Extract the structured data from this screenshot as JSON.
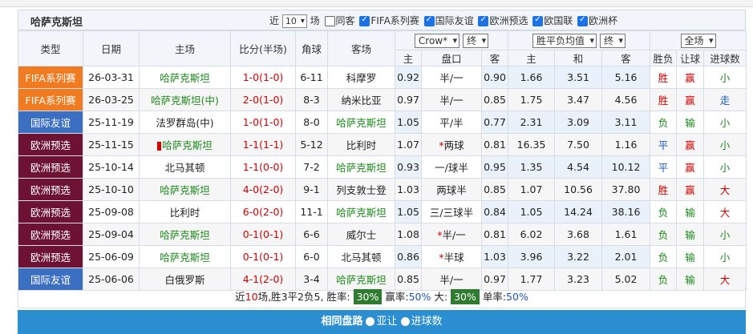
{
  "header": {
    "team": "哈萨克斯坦",
    "recent_prefix": "近",
    "recent_count": "10",
    "field_label": "场",
    "same_home_label": "同客",
    "filters": [
      {
        "label": "FIFA系列赛",
        "checked": true
      },
      {
        "label": "国际友谊",
        "checked": true
      },
      {
        "label": "欧洲预选",
        "checked": true
      },
      {
        "label": "欧国联",
        "checked": true
      },
      {
        "label": "欧洲杯",
        "checked": true
      }
    ]
  },
  "columns": {
    "type": "类型",
    "date": "日期",
    "home": "主场",
    "score": "比分(半场)",
    "corner": "角球",
    "away": "客场",
    "company_select": "Crow*",
    "period_select1": "终",
    "odds_select": "胜平负均值",
    "period_select2": "终",
    "scope_select": "全场",
    "result": "胜负",
    "handicap_result": "让球",
    "goals": "进球数",
    "sub": {
      "h1": "主",
      "line": "盘口",
      "a1": "客",
      "h2": "主",
      "draw": "和",
      "a2": "客"
    }
  },
  "rows": [
    {
      "league": "FIFA系列赛",
      "league_color": "#f07b20",
      "date": "26-03-31",
      "home": "哈萨克斯坦",
      "home_cls": "green",
      "score": "1-0",
      "half": "(1-0)",
      "corner": "6-11",
      "away": "科摩罗",
      "away_cls": "",
      "h1": "0.92",
      "line": "半/一",
      "a1": "0.90",
      "h2": "1.66",
      "d": "3.51",
      "a2": "5.16",
      "res": "胜",
      "res_cls": "red",
      "hcp": "赢",
      "hcp_cls": "red",
      "goals": "小",
      "goals_cls": "green"
    },
    {
      "league": "FIFA系列赛",
      "league_color": "#f07b20",
      "date": "26-03-25",
      "home": "哈萨克斯坦(中)",
      "home_cls": "green",
      "score": "2-0",
      "half": "(1-0)",
      "corner": "8-3",
      "away": "纳米比亚",
      "away_cls": "",
      "h1": "0.97",
      "line": "半/一",
      "a1": "0.85",
      "h2": "1.75",
      "d": "3.47",
      "a2": "4.56",
      "res": "胜",
      "res_cls": "red",
      "hcp": "赢",
      "hcp_cls": "red",
      "goals": "走",
      "goals_cls": "blue"
    },
    {
      "league": "国际友谊",
      "league_color": "#3b6fc2",
      "date": "25-11-19",
      "home": "法罗群岛(中)",
      "home_cls": "",
      "score": "1-0",
      "half": "(1-0)",
      "corner": "8-0",
      "away": "哈萨克斯坦",
      "away_cls": "green",
      "h1": "1.05",
      "line": "平/半",
      "a1": "0.77",
      "h2": "2.31",
      "d": "3.09",
      "a2": "3.11",
      "res": "负",
      "res_cls": "green",
      "hcp": "输",
      "hcp_cls": "green",
      "goals": "小",
      "goals_cls": "green"
    },
    {
      "league": "欧洲预选",
      "league_color": "#6d1232",
      "date": "25-11-15",
      "home": "哈萨克斯坦",
      "home_cls": "green",
      "home_mark": "1",
      "score": "1-1",
      "half": "(1-1)",
      "corner": "5-12",
      "away": "比利时",
      "away_cls": "",
      "h1": "1.07",
      "line": "两球",
      "line_mark": "*",
      "a1": "0.81",
      "h2": "16.35",
      "d": "7.50",
      "a2": "1.16",
      "res": "平",
      "res_cls": "blue",
      "hcp": "赢",
      "hcp_cls": "red",
      "goals": "小",
      "goals_cls": "green"
    },
    {
      "league": "欧洲预选",
      "league_color": "#6d1232",
      "date": "25-10-14",
      "home": "北马其顿",
      "home_cls": "",
      "score": "1-1",
      "half": "(0-0)",
      "corner": "7-2",
      "away": "哈萨克斯坦",
      "away_cls": "green",
      "h1": "0.93",
      "line": "一/球半",
      "a1": "0.95",
      "h2": "1.35",
      "d": "4.54",
      "a2": "10.12",
      "res": "平",
      "res_cls": "blue",
      "hcp": "赢",
      "hcp_cls": "red",
      "goals": "小",
      "goals_cls": "green"
    },
    {
      "league": "欧洲预选",
      "league_color": "#6d1232",
      "date": "25-10-10",
      "home": "哈萨克斯坦",
      "home_cls": "green",
      "score": "4-0",
      "half": "(2-0)",
      "corner": "9-1",
      "away": "列支敦士登",
      "away_cls": "",
      "h1": "1.03",
      "line": "两球半",
      "a1": "0.85",
      "h2": "1.07",
      "d": "10.56",
      "a2": "37.80",
      "res": "胜",
      "res_cls": "red",
      "hcp": "赢",
      "hcp_cls": "red",
      "goals": "大",
      "goals_cls": "red"
    },
    {
      "league": "欧洲预选",
      "league_color": "#6d1232",
      "date": "25-09-08",
      "home": "比利时",
      "home_cls": "",
      "score": "6-0",
      "half": "(2-0)",
      "corner": "11-1",
      "away": "哈萨克斯坦",
      "away_cls": "green",
      "h1": "1.05",
      "line": "三/三球半",
      "a1": "0.84",
      "h2": "1.05",
      "d": "14.24",
      "a2": "38.16",
      "res": "负",
      "res_cls": "green",
      "hcp": "输",
      "hcp_cls": "green",
      "goals": "大",
      "goals_cls": "red"
    },
    {
      "league": "欧洲预选",
      "league_color": "#6d1232",
      "date": "25-09-04",
      "home": "哈萨克斯坦",
      "home_cls": "green",
      "score": "0-1",
      "half": "(0-1)",
      "corner": "6-6",
      "away": "威尔士",
      "away_cls": "",
      "h1": "1.08",
      "line": "半/一",
      "line_mark": "*",
      "a1": "0.81",
      "h2": "6.02",
      "d": "3.68",
      "a2": "1.61",
      "res": "负",
      "res_cls": "green",
      "hcp": "输",
      "hcp_cls": "green",
      "goals": "小",
      "goals_cls": "green"
    },
    {
      "league": "欧洲预选",
      "league_color": "#6d1232",
      "date": "25-06-09",
      "home": "哈萨克斯坦",
      "home_cls": "green",
      "score": "0-1",
      "half": "(0-1)",
      "corner": "6-0",
      "away": "北马其顿",
      "away_cls": "",
      "h1": "0.86",
      "line": "半球",
      "line_mark": "*",
      "a1": "1.03",
      "h2": "3.96",
      "d": "3.22",
      "a2": "2.01",
      "res": "负",
      "res_cls": "green",
      "hcp": "输",
      "hcp_cls": "green",
      "goals": "小",
      "goals_cls": "green"
    },
    {
      "league": "国际友谊",
      "league_color": "#3b6fc2",
      "date": "25-06-06",
      "home": "白俄罗斯",
      "home_cls": "",
      "score": "4-1",
      "half": "(2-0)",
      "corner": "3-4",
      "away": "哈萨克斯坦",
      "away_cls": "green",
      "h1": "0.85",
      "line": "半/一",
      "a1": "0.97",
      "h2": "1.77",
      "d": "3.23",
      "a2": "5.02",
      "res": "负",
      "res_cls": "green",
      "hcp": "输",
      "hcp_cls": "green",
      "goals": "大",
      "goals_cls": "red"
    }
  ],
  "summary": {
    "t1": "近",
    "n": "10",
    "t2": "场,胜",
    "w": "3",
    "t3": "平",
    "d": "2",
    "t4": "负",
    "l": "5",
    "t5": ", 胜率:",
    "win_rate": "30%",
    "t6": " 赢率:",
    "cover_rate": "50%",
    "t7": " 大:",
    "over_rate": "30%",
    "t8": " 单率:",
    "odd_rate": "50%"
  },
  "same_handicap": {
    "title": "相同盘路",
    "opt1": "亚让",
    "opt2": "进球数"
  }
}
